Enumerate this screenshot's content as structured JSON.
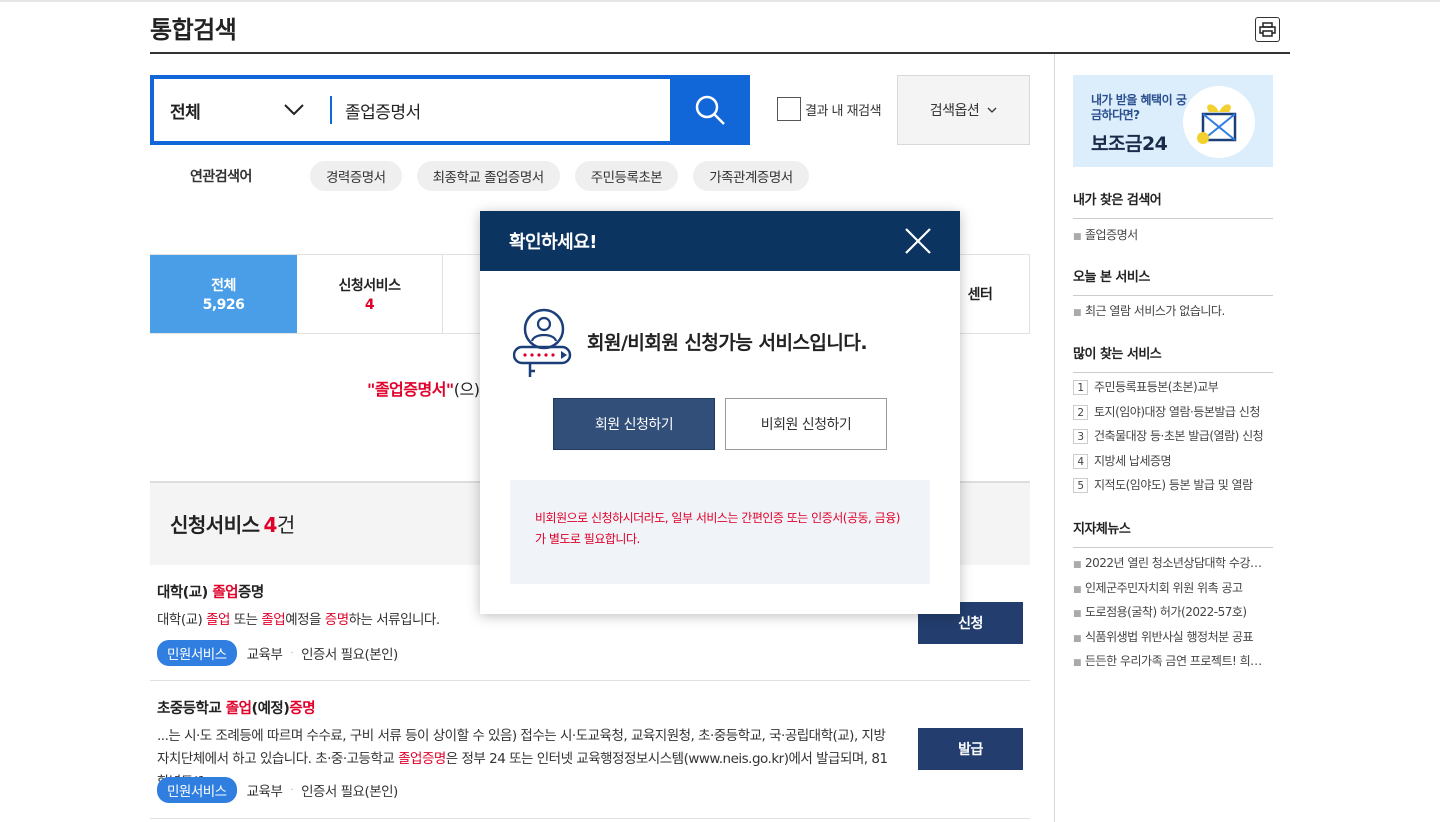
{
  "page": {
    "title": "통합검색"
  },
  "search": {
    "scope": "전체",
    "query": "졸업증명서",
    "research_label": "결과 내 재검색",
    "options_label": "검색옵션"
  },
  "related": {
    "label": "연관검색어",
    "tags": [
      "경력증명서",
      "최종학교 졸업증명서",
      "주민등록초본",
      "가족관계증명서"
    ]
  },
  "tabs": [
    {
      "label": "전체",
      "count": "5,926"
    },
    {
      "label": "신청서비스",
      "count": "4"
    },
    {
      "label": "센터",
      "count": ""
    }
  ],
  "result_msg": {
    "keyword": "\"졸업증명서\"",
    "suffix": "(으)로"
  },
  "section": {
    "title": "신청서비스",
    "count": "4",
    "unit": "건"
  },
  "items": [
    {
      "title_parts": [
        "대학(교) ",
        "졸업",
        "증명"
      ],
      "desc_parts": [
        "대학(교) ",
        "졸업",
        " 또는 ",
        "졸업",
        "예정을 ",
        "증명",
        "하는 서류입니다."
      ],
      "badge": "민원서비스",
      "org": "교육부",
      "auth": "인증서 필요(본인)",
      "action": "신청"
    },
    {
      "title_parts": [
        "초중등학교 ",
        "졸업",
        "(예정)",
        "증명"
      ],
      "desc_parts": [
        "...는 시·도 조례등에 따르며 수수료, 구비 서류 등이 상이할 수 있음) 접수는 시·도교육청, 교육지원청, 초·중등학교, 국·공립대학(교), 지방자치단체에서 하고 있습니다. 초·중·고등학교 ",
        "졸업증명",
        "은 정부 24 또는 인터넷 교육행정정보시스템(www.neis.go.kr)에서 발급되며, 81학년도(1…"
      ],
      "badge": "민원서비스",
      "org": "교육부",
      "auth": "인증서 필요(본인)",
      "action": "발급"
    }
  ],
  "sidebar": {
    "banner": {
      "sub": "내가 받을 혜택이 궁금하다면?",
      "main": "보조금24"
    },
    "my_searches": {
      "title": "내가 찾은 검색어",
      "items": [
        "졸업증명서"
      ]
    },
    "today_services": {
      "title": "오늘 본 서비스",
      "items": [
        "최근 열람 서비스가 없습니다."
      ]
    },
    "popular": {
      "title": "많이 찾는 서비스",
      "items": [
        {
          "rank": "1",
          "label": "주민등록표등본(초본)교부"
        },
        {
          "rank": "2",
          "label": "토지(임야)대장 열람·등본발급 신청"
        },
        {
          "rank": "3",
          "label": "건축물대장 등·초본 발급(열람) 신청"
        },
        {
          "rank": "4",
          "label": "지방세 납세증명"
        },
        {
          "rank": "5",
          "label": "지적도(임야도) 등본 발급 및 열람"
        }
      ]
    },
    "news": {
      "title": "지자체뉴스",
      "items": [
        "2022년 열린 청소년상담대학 수강…",
        "인제군주민자치회 위원 위촉 공고",
        "도로점용(굴착) 허가(2022-57호)",
        "식품위생법 위반사실 행정처분 공표",
        "든든한 우리가족 금연 프로젝트! 희…"
      ]
    }
  },
  "modal": {
    "title": "확인하세요!",
    "message": "회원/비회원 신청가능 서비스입니다.",
    "member_btn": "회원 신청하기",
    "guest_btn": "비회원 신청하기",
    "note": "비회원으로 신청하시더라도, 일부 서비스는 간편인증 또는 인증서(공동, 금융)가 별도로 필요합니다."
  },
  "colors": {
    "primary": "#1167d8",
    "navy": "#0b3560",
    "highlight": "#e0002a",
    "tab_active": "#4a9ee8",
    "action_btn": "#233e6e"
  }
}
